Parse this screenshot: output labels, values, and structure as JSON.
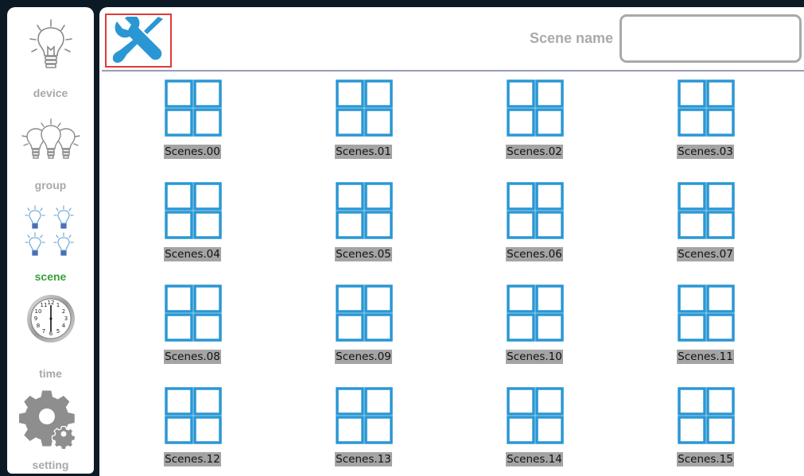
{
  "sidebar": {
    "items": [
      {
        "label": "device",
        "icon": "bulb-icon",
        "active": false
      },
      {
        "label": "group",
        "icon": "bulb-group-icon",
        "active": false
      },
      {
        "label": "scene",
        "icon": "scene-bulbs-icon",
        "active": true
      },
      {
        "label": "time",
        "icon": "clock-icon",
        "active": false
      },
      {
        "label": "setting",
        "icon": "gear-icon",
        "active": false
      }
    ]
  },
  "header": {
    "tools_icon": "wrench-screwdriver-icon",
    "scene_name_label": "Scene name",
    "scene_name_value": "",
    "scene_name_placeholder": ""
  },
  "scenes": [
    "Scenes.00",
    "Scenes.01",
    "Scenes.02",
    "Scenes.03",
    "Scenes.04",
    "Scenes.05",
    "Scenes.06",
    "Scenes.07",
    "Scenes.08",
    "Scenes.09",
    "Scenes.10",
    "Scenes.11",
    "Scenes.12",
    "Scenes.13",
    "Scenes.14",
    "Scenes.15"
  ],
  "colors": {
    "accent": "#2a97d4",
    "active_label": "#37a33a",
    "tools_border": "#e03a3a",
    "frame": "#0c1a26"
  }
}
